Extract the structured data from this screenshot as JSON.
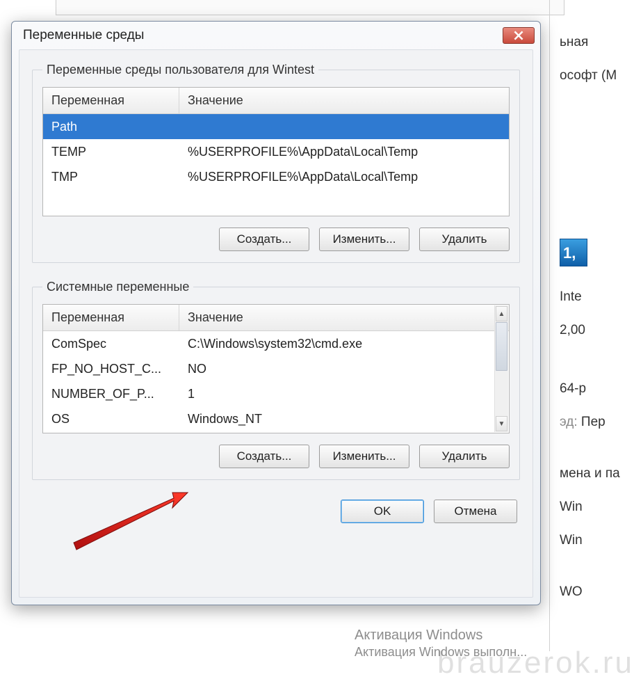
{
  "dialog": {
    "title": "Переменные среды",
    "user_group_legend": "Переменные среды пользователя для Wintest",
    "system_group_legend": "Системные переменные",
    "columns": {
      "variable": "Переменная",
      "value": "Значение"
    },
    "user_vars": [
      {
        "name": "Path",
        "value": "",
        "selected": true
      },
      {
        "name": "TEMP",
        "value": "%USERPROFILE%\\AppData\\Local\\Temp",
        "selected": false
      },
      {
        "name": "TMP",
        "value": "%USERPROFILE%\\AppData\\Local\\Temp",
        "selected": false
      }
    ],
    "system_vars": [
      {
        "name": "ComSpec",
        "value": "C:\\Windows\\system32\\cmd.exe"
      },
      {
        "name": "FP_NO_HOST_C...",
        "value": "NO"
      },
      {
        "name": "NUMBER_OF_P...",
        "value": "1"
      },
      {
        "name": "OS",
        "value": "Windows_NT"
      }
    ],
    "buttons": {
      "create": "Создать...",
      "edit": "Изменить...",
      "delete": "Удалить",
      "ok": "OK",
      "cancel": "Отмена"
    }
  },
  "background": {
    "right_lines": [
      "ьная",
      "ософт (М",
      "",
      "Inte",
      "2,00",
      "",
      "64-р",
      "Пер",
      "",
      "мена и па",
      "Win",
      "Win",
      "",
      "WO"
    ],
    "icon_label": "1,",
    "activation_title": "Активация Windows",
    "activation_sub": "Активация Windows выполн...",
    "watermark": "brauzerok.ru"
  }
}
